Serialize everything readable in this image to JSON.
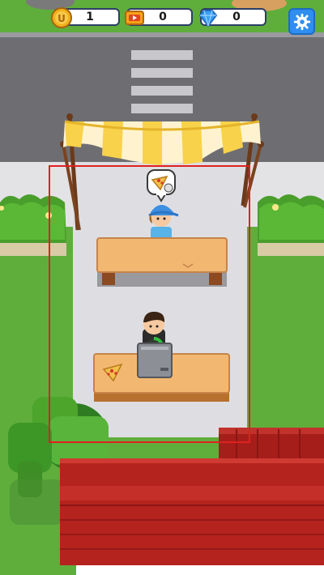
{
  "hud": {
    "coins": "1",
    "tickets": "0",
    "gems": "0"
  },
  "icons": {
    "coin": "coin-icon",
    "ticket": "ticket-icon",
    "gem": "gem-icon",
    "settings": "gear-icon"
  },
  "colors": {
    "settings_button": "#2f8ef0",
    "highlight_frame": "#e02020",
    "awning_yellow": "#f8d24a",
    "roof_red": "#b5231e"
  },
  "scene": {
    "order_item": "pizza-slice",
    "counter_item": "pizza-slice"
  }
}
